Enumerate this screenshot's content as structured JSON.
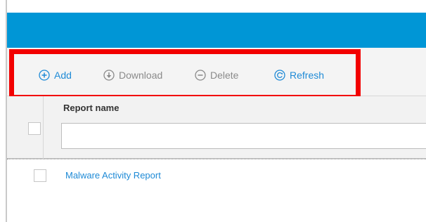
{
  "theme": {
    "header_color": "#0096d6",
    "link_color": "#1e8ad6",
    "disabled_color": "#8a8a8a",
    "highlight_color": "#f20000"
  },
  "toolbar": {
    "add": {
      "label": "Add",
      "icon": "plus-circle-icon",
      "enabled": true
    },
    "download": {
      "label": "Download",
      "icon": "download-circle-icon",
      "enabled": false
    },
    "delete": {
      "label": "Delete",
      "icon": "minus-circle-icon",
      "enabled": false
    },
    "refresh": {
      "label": "Refresh",
      "icon": "refresh-circle-icon",
      "enabled": true
    }
  },
  "table": {
    "columns": [
      {
        "header": "Report name",
        "filter_value": "",
        "filter_placeholder": ""
      }
    ],
    "rows": [
      {
        "report_name": "Malware Activity Report",
        "selected": false
      }
    ]
  }
}
